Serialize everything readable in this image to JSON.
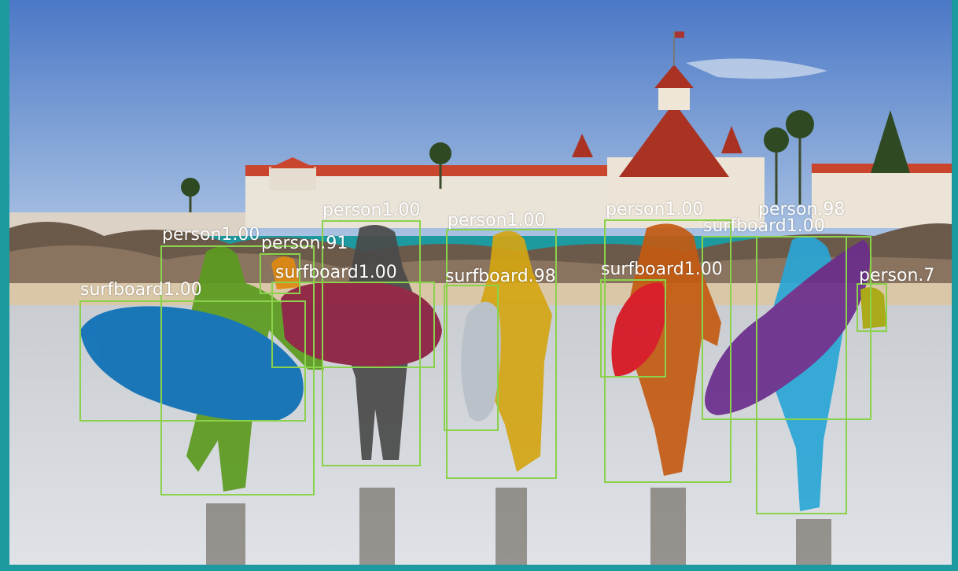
{
  "image": {
    "border_color": "#1d9aa0",
    "box_color": "#8bd24c"
  },
  "detections": [
    {
      "label": "surfboard1.00",
      "mask_color": "#0b6fb5"
    },
    {
      "label": "person1.00",
      "mask_color": "#5c9a1f"
    },
    {
      "label": "person.91",
      "mask_color": "#e08a12"
    },
    {
      "label": "surfboard1.00",
      "mask_color": "#8b1e3f"
    },
    {
      "label": "person1.00",
      "mask_color": "#4a4a4a"
    },
    {
      "label": "surfboard.98",
      "mask_color": "#b9c0c8"
    },
    {
      "label": "person1.00",
      "mask_color": "#d4a514"
    },
    {
      "label": "surfboard1.00",
      "mask_color": "#d81420"
    },
    {
      "label": "person1.00",
      "mask_color": "#c45b12"
    },
    {
      "label": "surfboard1.00",
      "mask_color": "#6a2d8c"
    },
    {
      "label": "person.98",
      "mask_color": "#2aa6d6"
    },
    {
      "label": "person.7",
      "mask_color": "#a8a80c"
    }
  ]
}
